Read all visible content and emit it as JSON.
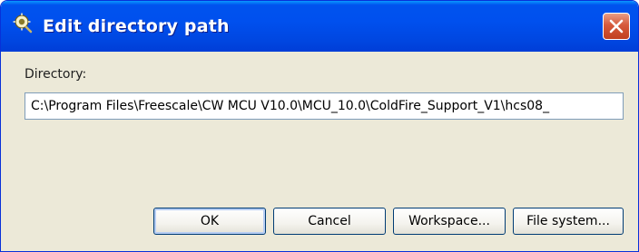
{
  "window": {
    "title": "Edit directory path",
    "icon": "eclipse-perspective-icon",
    "close_icon": "close-icon"
  },
  "form": {
    "directory_label": "Directory:",
    "directory_value": "C:\\Program Files\\Freescale\\CW MCU V10.0\\MCU_10.0\\ColdFire_Support_V1\\hcs08_"
  },
  "buttons": {
    "ok": "OK",
    "cancel": "Cancel",
    "workspace": "Workspace...",
    "file_system": "File system..."
  },
  "colors": {
    "titlebar": "#0053ee",
    "close_button": "#d6593b",
    "dialog_background": "#ece9d8",
    "button_border": "#003c74"
  }
}
